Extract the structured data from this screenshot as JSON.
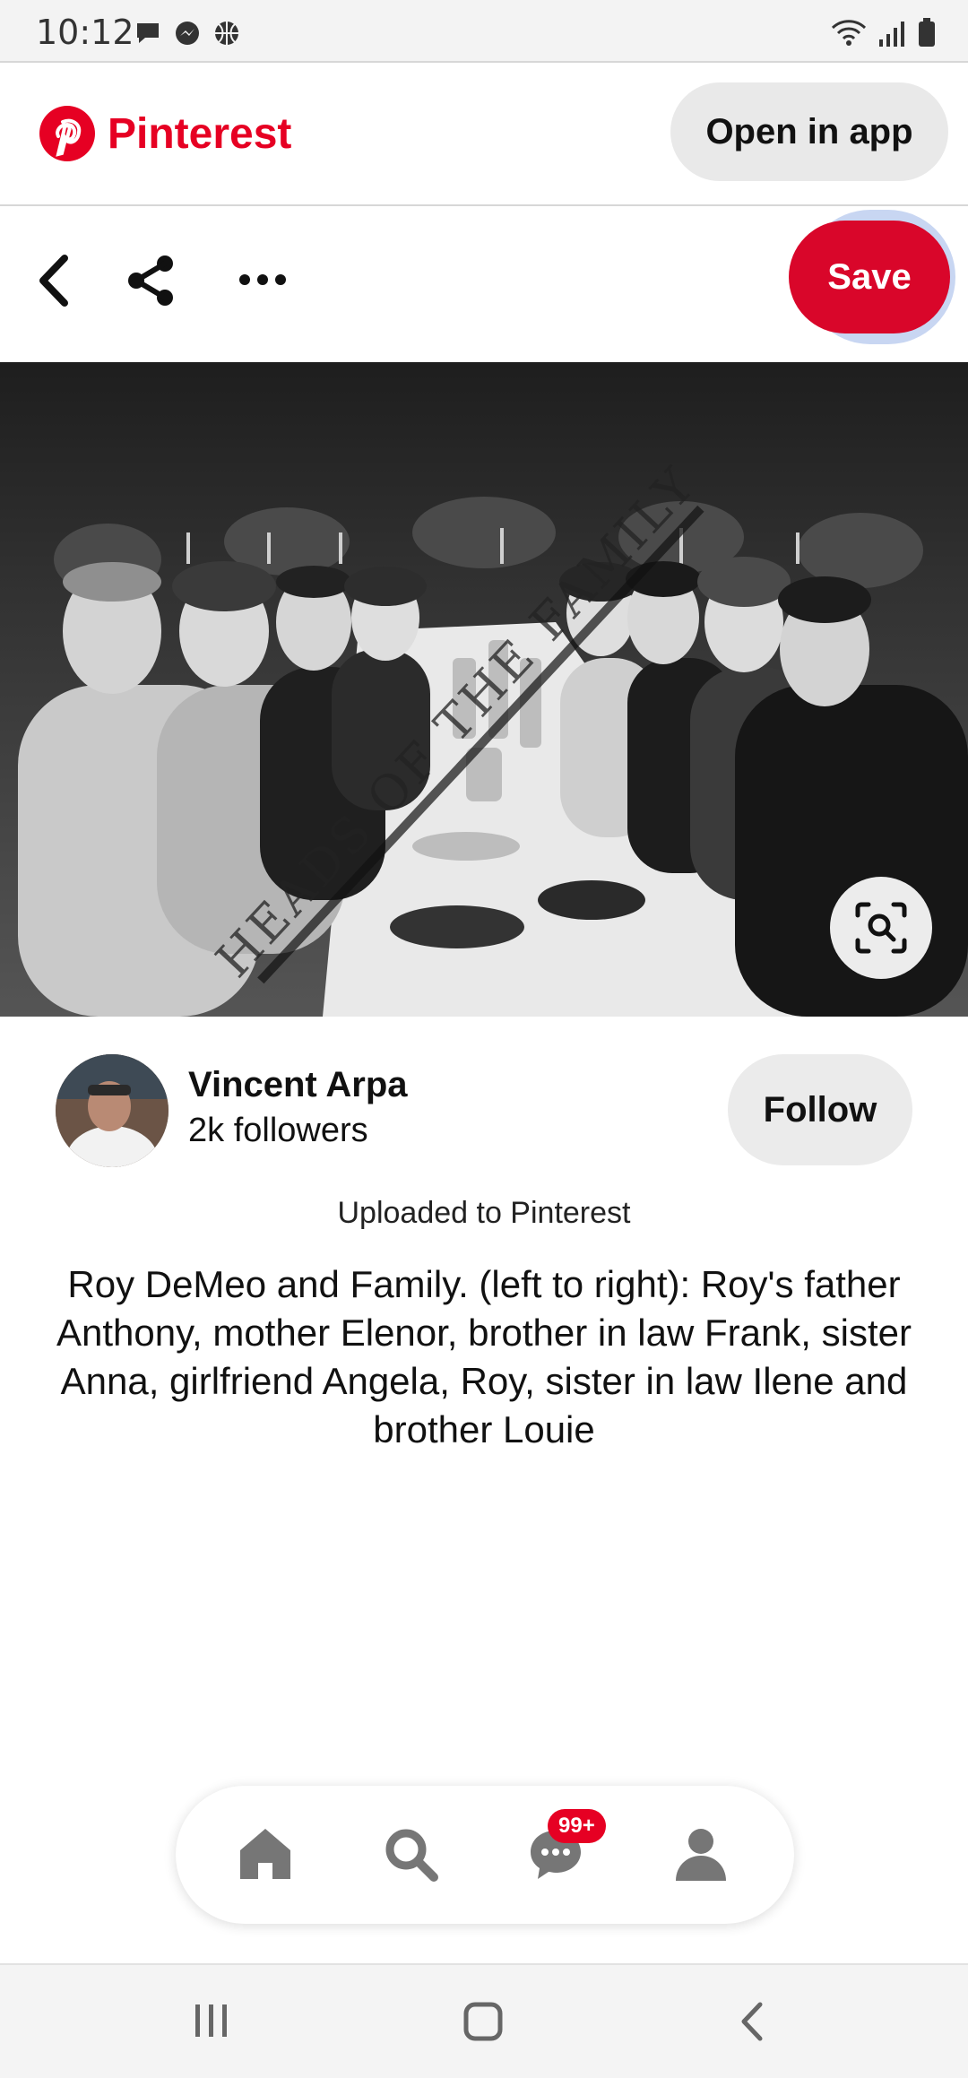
{
  "status_bar": {
    "time": "10:12",
    "left_icons": [
      "chat-bubble-icon",
      "messenger-icon",
      "basketball-icon"
    ],
    "right_icons": [
      "wifi-icon",
      "signal-icon",
      "battery-icon"
    ]
  },
  "header": {
    "brand": "Pinterest",
    "open_in_app": "Open in app"
  },
  "action_bar": {
    "icons": [
      "back-icon",
      "share-icon",
      "more-icon"
    ],
    "save_label": "Save"
  },
  "pin": {
    "image_alt": "Black and white photo of a family seated at a long banquet table",
    "watermark": "HEADS OF THE FAMILY",
    "author": {
      "name": "Vincent Arpa",
      "followers": "2k followers"
    },
    "follow_label": "Follow",
    "uploaded_text": "Uploaded to Pinterest",
    "description": "Roy DeMeo and Family. (left to right): Roy's father Anthony, mother Elenor, brother in law Frank, sister Anna, girlfriend Angela, Roy, sister in law Ilene and brother Louie"
  },
  "bottom_nav": {
    "items": [
      "home-icon",
      "search-icon",
      "messages-icon",
      "profile-icon"
    ],
    "messages_badge": "99+"
  },
  "system_nav": [
    "recent-apps-icon",
    "home-button-icon",
    "back-nav-icon"
  ],
  "colors": {
    "brand": "#e60023",
    "save": "#d9062a",
    "button_gray": "#ebebeb"
  }
}
